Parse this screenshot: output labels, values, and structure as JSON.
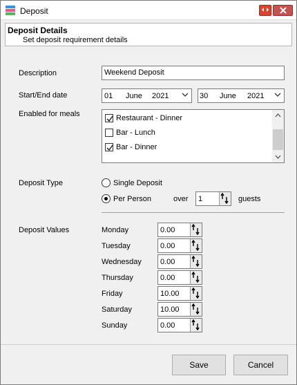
{
  "window": {
    "title": "Deposit"
  },
  "header": {
    "title": "Deposit Details",
    "subtitle": "Set deposit requirement details"
  },
  "form": {
    "description_label": "Description",
    "description_value": "Weekend Deposit",
    "dates_label": "Start/End date",
    "start_date": {
      "day": "01",
      "month": "June",
      "year": "2021"
    },
    "end_date": {
      "day": "30",
      "month": "June",
      "year": "2021"
    },
    "meals_label": "Enabled for meals",
    "meals": [
      {
        "label": "Restaurant - Dinner",
        "checked": true
      },
      {
        "label": "Bar - Lunch",
        "checked": false
      },
      {
        "label": "Bar - Dinner",
        "checked": true
      }
    ],
    "deposit_type_label": "Deposit Type",
    "deposit_type_options": [
      {
        "label": "Single Deposit",
        "selected": false
      },
      {
        "label": "Per Person",
        "selected": true
      }
    ],
    "over_label": "over",
    "guests_value": "1",
    "guests_label": "guests",
    "deposit_values_label": "Deposit Values",
    "days": [
      {
        "day": "Monday",
        "value": "0.00"
      },
      {
        "day": "Tuesday",
        "value": "0.00"
      },
      {
        "day": "Wednesday",
        "value": "0.00"
      },
      {
        "day": "Thursday",
        "value": "0.00"
      },
      {
        "day": "Friday",
        "value": "10.00"
      },
      {
        "day": "Saturday",
        "value": "10.00"
      },
      {
        "day": "Sunday",
        "value": "0.00"
      }
    ]
  },
  "buttons": {
    "save": "Save",
    "cancel": "Cancel"
  },
  "icons": {
    "app": "deposit-app-icon",
    "spin": "spin-up-down-icon",
    "dropdown": "chevron-down-icon"
  }
}
